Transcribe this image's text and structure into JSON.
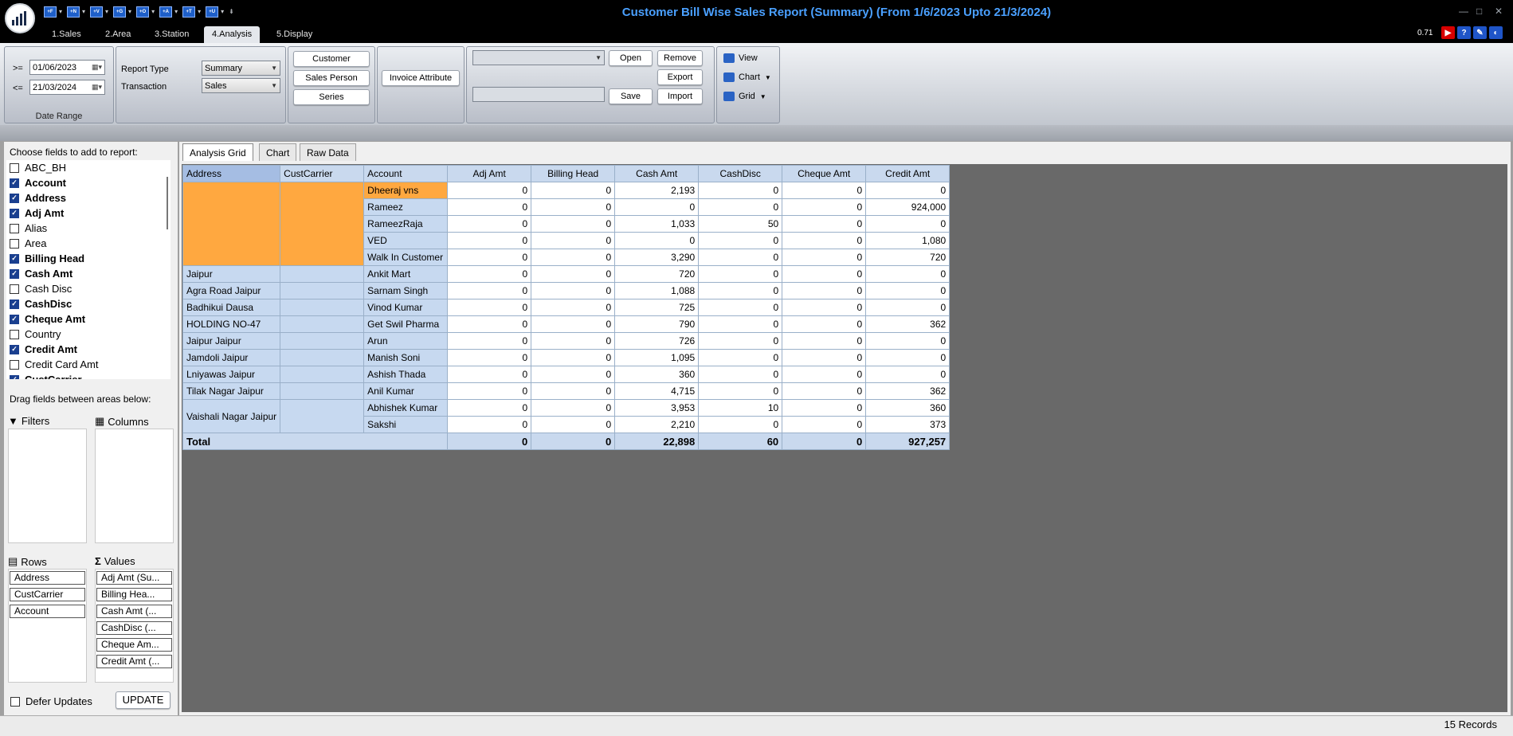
{
  "window": {
    "title": "Customer Bill Wise Sales Report (Summary) (From 1/6/2023 Upto 21/3/2024)",
    "version": "0.71",
    "quick_access": [
      "+F",
      "+N",
      "+V",
      "+G",
      "+O",
      "+A",
      "+T",
      "+U"
    ]
  },
  "tabs": [
    "1.Sales",
    "2.Area",
    "3.Station",
    "4.Analysis",
    "5.Display"
  ],
  "ribbon": {
    "date_range": {
      "ge_label": ">=",
      "le_label": "<=",
      "from": "01/06/2023",
      "to": "21/03/2024",
      "caption": "Date Range"
    },
    "report_type_label": "Report Type",
    "report_type_value": "Summary",
    "transaction_label": "Transaction",
    "transaction_value": "Sales",
    "customer": "Customer",
    "sales_person": "Sales Person",
    "series": "Series",
    "invoice_attribute": "Invoice Attribute",
    "layout_combo": "",
    "layout_name": "",
    "open": "Open",
    "remove": "Remove",
    "export": "Export",
    "save": "Save",
    "import": "Import",
    "view": "View",
    "chart": "Chart",
    "grid": "Grid"
  },
  "field_chooser": {
    "title": "Choose fields to add to report:",
    "fields": [
      {
        "name": "ABC_BH",
        "checked": false
      },
      {
        "name": "Account",
        "checked": true
      },
      {
        "name": "Address",
        "checked": true
      },
      {
        "name": "Adj Amt",
        "checked": true
      },
      {
        "name": "Alias",
        "checked": false
      },
      {
        "name": "Area",
        "checked": false
      },
      {
        "name": "Billing Head",
        "checked": true
      },
      {
        "name": "Cash Amt",
        "checked": true
      },
      {
        "name": "Cash Disc",
        "checked": false
      },
      {
        "name": "CashDisc",
        "checked": true
      },
      {
        "name": "Cheque Amt",
        "checked": true
      },
      {
        "name": "Country",
        "checked": false
      },
      {
        "name": "Credit Amt",
        "checked": true
      },
      {
        "name": "Credit Card Amt",
        "checked": false
      },
      {
        "name": "CustCarrier",
        "checked": true
      }
    ],
    "drag_label": "Drag fields between areas below:",
    "filters_label": "Filters",
    "columns_label": "Columns",
    "rows_label": "Rows",
    "values_label": "Values",
    "rows": [
      "Address",
      "CustCarrier",
      "Account"
    ],
    "values": [
      "Adj Amt (Su...",
      "Billing Hea...",
      "Cash Amt (...",
      "CashDisc (...",
      "Cheque Am...",
      "Credit Amt (..."
    ],
    "defer_updates": "Defer Updates",
    "update": "UPDATE"
  },
  "grid_tabs": [
    "Analysis Grid",
    "Chart",
    "Raw Data"
  ],
  "grid": {
    "row_headers": [
      "Address",
      "CustCarrier",
      "Account"
    ],
    "value_headers": [
      "Adj Amt",
      "Billing Head",
      "Cash Amt",
      "CashDisc",
      "Cheque Amt",
      "Credit Amt"
    ],
    "groups": [
      {
        "address": "",
        "carrier": "",
        "orange": true,
        "rows": [
          {
            "account": "Dheeraj vns",
            "vals": [
              "0",
              "0",
              "2,193",
              "0",
              "0",
              "0"
            ]
          },
          {
            "account": "Rameez",
            "vals": [
              "0",
              "0",
              "0",
              "0",
              "0",
              "924,000"
            ]
          },
          {
            "account": "RameezRaja",
            "vals": [
              "0",
              "0",
              "1,033",
              "50",
              "0",
              "0"
            ]
          },
          {
            "account": "VED",
            "vals": [
              "0",
              "0",
              "0",
              "0",
              "0",
              "1,080"
            ]
          },
          {
            "account": "Walk In Customer",
            "vals": [
              "0",
              "0",
              "3,290",
              "0",
              "0",
              "720"
            ]
          }
        ]
      },
      {
        "address": " Jaipur",
        "carrier": "",
        "rows": [
          {
            "account": "Ankit Mart",
            "vals": [
              "0",
              "0",
              "720",
              "0",
              "0",
              "0"
            ]
          }
        ]
      },
      {
        "address": "Agra Road Jaipur",
        "carrier": "",
        "rows": [
          {
            "account": "Sarnam Singh",
            "vals": [
              "0",
              "0",
              "1,088",
              "0",
              "0",
              "0"
            ]
          }
        ]
      },
      {
        "address": "Badhikui Dausa",
        "carrier": "",
        "rows": [
          {
            "account": "Vinod Kumar",
            "vals": [
              "0",
              "0",
              "725",
              "0",
              "0",
              "0"
            ]
          }
        ]
      },
      {
        "address": "HOLDING NO-47",
        "carrier": "",
        "rows": [
          {
            "account": "Get Swil Pharma",
            "vals": [
              "0",
              "0",
              "790",
              "0",
              "0",
              "362"
            ]
          }
        ]
      },
      {
        "address": "Jaipur Jaipur",
        "carrier": "",
        "rows": [
          {
            "account": "Arun",
            "vals": [
              "0",
              "0",
              "726",
              "0",
              "0",
              "0"
            ]
          }
        ]
      },
      {
        "address": "Jamdoli Jaipur",
        "carrier": "",
        "rows": [
          {
            "account": "Manish Soni",
            "vals": [
              "0",
              "0",
              "1,095",
              "0",
              "0",
              "0"
            ]
          }
        ]
      },
      {
        "address": "Lniyawas Jaipur",
        "carrier": "",
        "rows": [
          {
            "account": "Ashish Thada",
            "vals": [
              "0",
              "0",
              "360",
              "0",
              "0",
              "0"
            ]
          }
        ]
      },
      {
        "address": "Tilak Nagar Jaipur",
        "carrier": "",
        "rows": [
          {
            "account": "Anil Kumar",
            "vals": [
              "0",
              "0",
              "4,715",
              "0",
              "0",
              "362"
            ]
          }
        ]
      },
      {
        "address": "Vaishali Nagar Jaipur",
        "carrier": "",
        "rows": [
          {
            "account": "Abhishek Kumar",
            "vals": [
              "0",
              "0",
              "3,953",
              "10",
              "0",
              "360"
            ]
          },
          {
            "account": "Sakshi",
            "vals": [
              "0",
              "0",
              "2,210",
              "0",
              "0",
              "373"
            ]
          }
        ]
      }
    ],
    "total_label": "Total",
    "totals": [
      "0",
      "0",
      "22,898",
      "60",
      "0",
      "927,257"
    ]
  },
  "status": {
    "records": "15 Records"
  }
}
